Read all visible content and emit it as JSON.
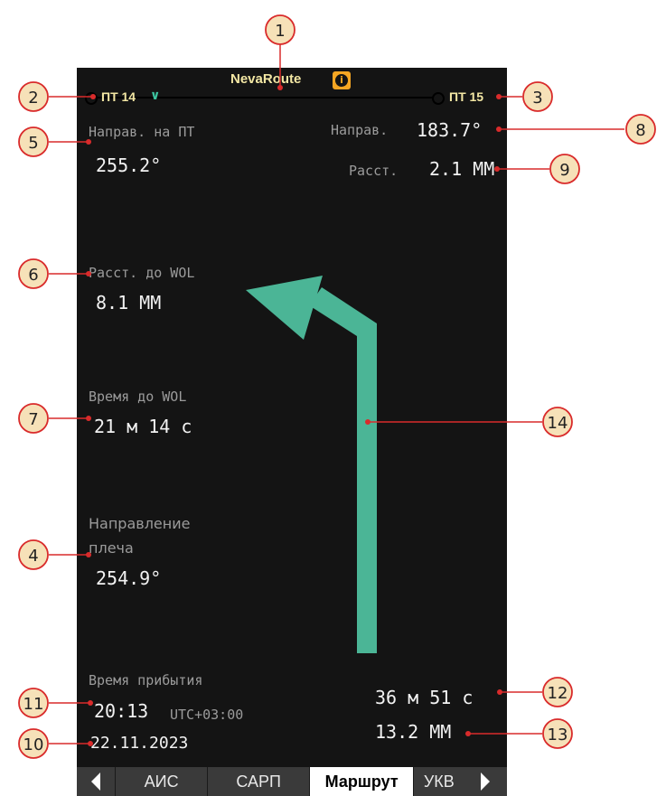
{
  "colors": {
    "screen_bg": "#141414",
    "accent_arrow": "#4bb596",
    "title_yellow": "#f3e7a4",
    "info_orange": "#f5a623",
    "callout_red": "#d92b2b",
    "callout_circle_fill": "#f6e1b8"
  },
  "header": {
    "app_title": "NevaRoute",
    "info_icon": "info-icon"
  },
  "route": {
    "prev_waypoint": "ПТ 14",
    "next_waypoint": "ПТ 15",
    "prev_chevron": "chevron-down-icon"
  },
  "left_panel": {
    "bearing_label": "Направ. на ПТ",
    "bearing_value": "255.2°",
    "wol_dist_label": "Расст. до WOL",
    "wol_dist_value": "8.1 ММ",
    "wol_time_label": "Время до WOL",
    "wol_time_value": "21 м 14 с",
    "leg_dir_label_1": "Направление",
    "leg_dir_label_2": "плеча",
    "leg_dir_value": "254.9°",
    "eta_label": "Время прибытия",
    "eta_time": "20:13",
    "eta_tz": "UTC+03:00",
    "eta_date": "22.11.2023"
  },
  "right_panel": {
    "dir_label": "Направ.",
    "dir_value": "183.7°",
    "dist_label": "Расст.",
    "dist_value": "2.1 ММ",
    "remaining_time": "36 м 51 с",
    "remaining_dist": "13.2 ММ"
  },
  "tabs": {
    "left_arrow": "arrow-left-icon",
    "items": [
      "АИС",
      "САРП",
      "Маршрут",
      "УКВ"
    ],
    "active": "Маршрут",
    "right_arrow": "arrow-right-icon"
  },
  "callouts": [
    "1",
    "2",
    "3",
    "4",
    "5",
    "6",
    "7",
    "8",
    "9",
    "10",
    "11",
    "12",
    "13",
    "14"
  ]
}
